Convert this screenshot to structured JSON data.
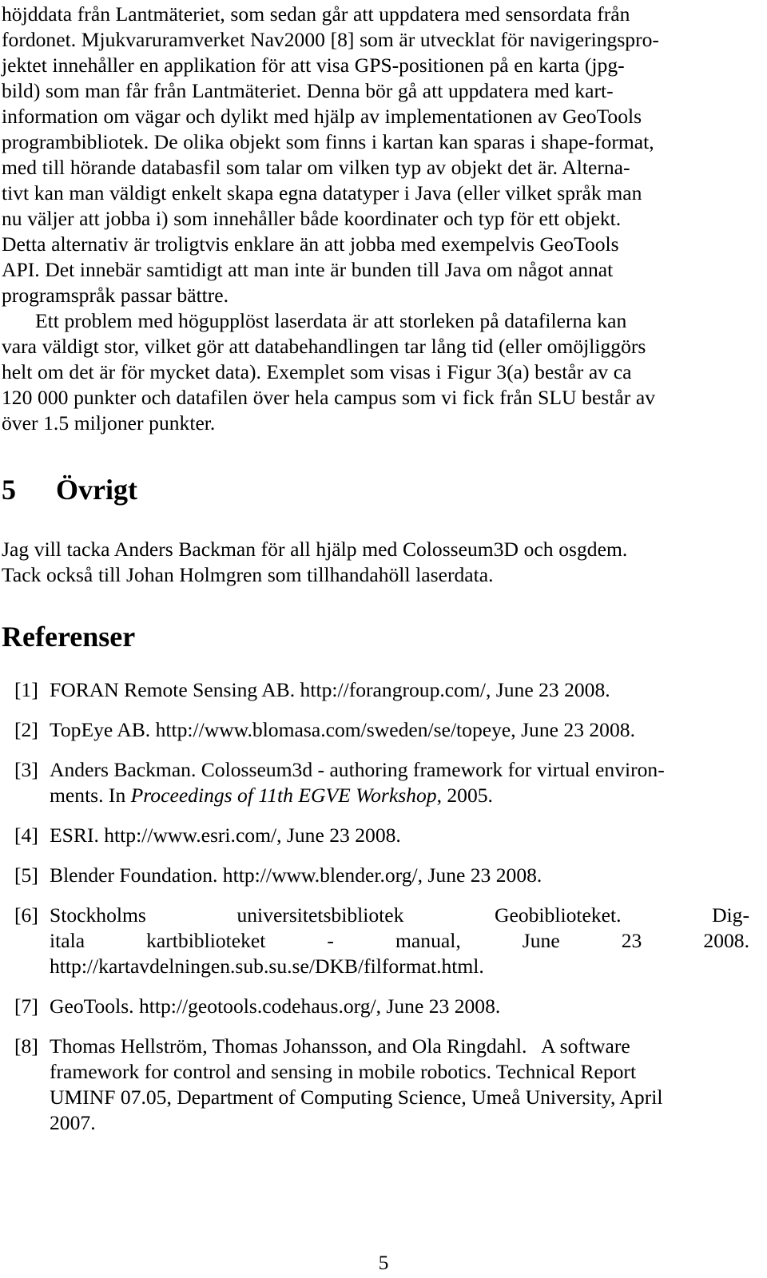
{
  "document": {
    "language": "sv",
    "page_number": "5"
  },
  "body": {
    "paragraph_1": {
      "lines": [
        "höjddata från Lantmäteriet, som sedan går att uppdatera med sensordata från",
        "fordonet. Mjukvaruramverket Nav2000 [8] som är utvecklat för navigeringspro-",
        "jektet innehåller en applikation för att visa GPS-positionen på en karta (jpg-",
        "bild) som man får från Lantmäteriet. Denna bör gå att uppdatera med kart-",
        "information om vägar och dylikt med hjälp av implementationen av GeoTools",
        "programbibliotek. De olika objekt som finns i kartan kan sparas i shape-format,",
        "med till hörande databasfil som talar om vilken typ av objekt det är. Alterna-",
        "tivt kan man väldigt enkelt skapa egna datatyper i Java (eller vilket språk man",
        "nu väljer att jobba i) som innehåller både koordinater och typ för ett objekt.",
        "Detta alternativ är troligtvis enklare än att jobba med exempelvis GeoTools",
        "API. Det innebär samtidigt att man inte är bunden till Java om något annat",
        "programspråk passar bättre."
      ]
    },
    "paragraph_2": {
      "lines": [
        "Ett problem med högupplöst laserdata är att storleken på datafilerna kan",
        "vara väldigt stor, vilket gör att databehandlingen tar lång tid (eller omöjliggörs",
        "helt om det är för mycket data). Exemplet som visas i Figur 3(a) består av ca",
        "120 000 punkter och datafilen över hela campus som vi fick från SLU består av",
        "över 1.5 miljoner punkter."
      ]
    }
  },
  "section": {
    "number": "5",
    "title": "Övrigt",
    "paragraph": {
      "lines": [
        "Jag vill tacka Anders Backman för all hjälp med Colosseum3D och osgdem.",
        "Tack också till Johan Holmgren som tillhandahöll laserdata."
      ]
    }
  },
  "references": {
    "heading": "Referenser",
    "items": [
      {
        "label": "[1]",
        "lines": [
          "FORAN Remote Sensing AB. http://forangroup.com/, June 23 2008."
        ]
      },
      {
        "label": "[2]",
        "lines": [
          "TopEye AB. http://www.blomasa.com/sweden/se/topeye, June 23 2008."
        ]
      },
      {
        "label": "[3]",
        "line_1": "Anders Backman. Colosseum3d - authoring framework for virtual environ-",
        "line_2_a": "ments. In ",
        "line_2_italic": "Proceedings of 11th EGVE Workshop",
        "line_2_b": ", 2005."
      },
      {
        "label": "[4]",
        "lines": [
          "ESRI. http://www.esri.com/, June 23 2008."
        ]
      },
      {
        "label": "[5]",
        "lines": [
          "Blender Foundation. http://www.blender.org/, June 23 2008."
        ]
      },
      {
        "label": "[6]",
        "line_1_words": [
          "Stockholms",
          "universitetsbibliotek",
          "Geobiblioteket.",
          "Dig-"
        ],
        "line_2_words": [
          "itala",
          "kartbiblioteket",
          "-",
          "manual,",
          "June",
          "23",
          "2008."
        ],
        "line_3": "http://kartavdelningen.sub.su.se/DKB/filformat.html."
      },
      {
        "label": "[7]",
        "lines": [
          "GeoTools. http://geotools.codehaus.org/, June 23 2008."
        ]
      },
      {
        "label": "[8]",
        "lines": [
          "Thomas Hellström, Thomas Johansson, and Ola Ringdahl.   A software",
          "framework for control and sensing in mobile robotics. Technical Report",
          "UMINF 07.05, Department of Computing Science, Umeå University, April",
          "2007."
        ]
      }
    ]
  }
}
